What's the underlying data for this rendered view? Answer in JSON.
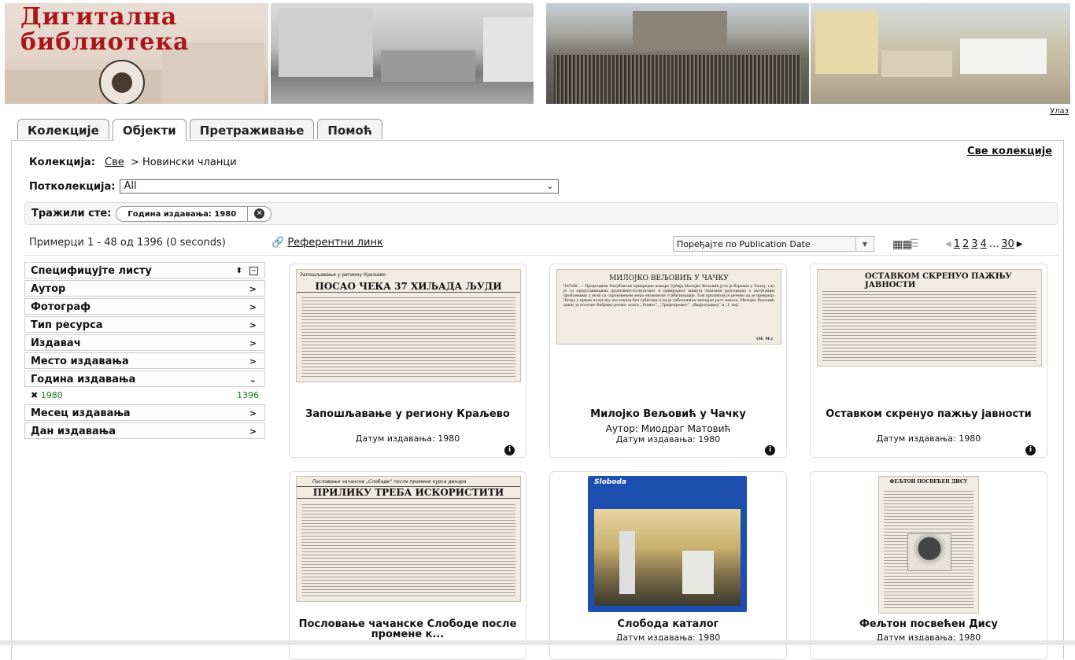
{
  "banner": {
    "title_line1": "Дигитална",
    "title_line2": "библиотека",
    "seal_text": "Градска библиотека Владислав Петковић Дис Чачак"
  },
  "header": {
    "exit_label": "Улаз"
  },
  "tabs": [
    {
      "label": "Колекције"
    },
    {
      "label": "Објекти"
    },
    {
      "label": "Претраживање"
    },
    {
      "label": "Помоћ"
    }
  ],
  "collection": {
    "label": "Колекција:",
    "all_link": "Све",
    "separator": ">",
    "current": "Новински чланци",
    "all_collections_link": "Све колекције"
  },
  "subcollection": {
    "label": "Потколекција:",
    "value": "All"
  },
  "searched": {
    "label": "Тражили сте:",
    "chip": "Година издавања: 1980"
  },
  "results": {
    "summary": "Примерци 1 - 48 од 1396 (0 seconds)",
    "ref_link": "Референтни линк",
    "sort_value": "Поређајте по Publication Date"
  },
  "pager": {
    "prev": "◀",
    "pages": [
      "1",
      "2",
      "3",
      "4"
    ],
    "ellipsis": "...",
    "last": "30",
    "next": "▶"
  },
  "facets": {
    "header": "Специфицујте листу",
    "items": [
      {
        "label": "Аутор"
      },
      {
        "label": "Фотограф"
      },
      {
        "label": "Тип ресурса"
      },
      {
        "label": "Издавач"
      },
      {
        "label": "Место издавања"
      },
      {
        "label": "Година издавања"
      },
      {
        "label": "Месец издавања"
      },
      {
        "label": "Дан издавања"
      }
    ],
    "year_value": {
      "label": "1980",
      "count": "1396"
    }
  },
  "cards": [
    {
      "title": "Запошљавање у региону Краљево",
      "meta": "Датум издавања: 1980",
      "thumb_kicker": "Запошљавање у региону Краљево",
      "thumb_headline": "ПОСАО ЧЕКА 37 ХИЉАДА ЉУДИ"
    },
    {
      "title": "Милојко Вељовић у Чачку",
      "meta": "Аутор: Миодраг Матовић",
      "meta2": "Датум издавања: 1980",
      "thumb_headline": "МИЛОЈКО ВЕЉОВИЋ У ЧАЧКУ",
      "thumb_body": "ЧАЧАК: — Председник Републичке привредне коморе Србије Милојко Вељовић јуче је боравио у Чачку, где је са представницима друштвено-политичког и привредног живота општине разговарао о актуелним проблемима у вези са спровођењем мера економске стабилизације. Том приликом је речено да је привреда Чачка у првом полугођу пословала без губитака и да је забележила значајан раст извоза. Милојко Вељовић данас је посетио Фабрику резног алата „Техмос“, „Трафопромет“, „Хидроградњу“ и „1. мај“.",
      "thumb_sig": "(М. М.)"
    },
    {
      "title": "Оставком скренуо пажњу јавности",
      "meta": "Датум издавања: 1980",
      "thumb_headline": "ОСТАВКОМ СКРЕНУО ПАЖЊУ ЈАВНОСТИ"
    },
    {
      "title": "Пословање чачанске Слободе после промене к...",
      "thumb_kicker": "Пословање чачанске „Слободе“ после промене курса динара",
      "thumb_headline": "ПРИЛИКУ ТРЕБА ИСКОРИСТИТИ"
    },
    {
      "title": "Слобода каталог",
      "meta": "Датум издавања: 1980",
      "thumb_brand": "Sloboda"
    },
    {
      "title": "Фељтон посвећен Дису",
      "meta": "Датум издавања: 1980",
      "thumb_kicker": "ФЕЉТОН ПОСВЕЋЕН ДИСУ"
    }
  ],
  "colors": {
    "banner_red": "#a8161a",
    "facet_green": "#1a7a20",
    "slobota_blue": "#1d4fb0"
  },
  "icons": [
    "seal-logo",
    "link-icon",
    "grid-view-icon",
    "list-view-icon",
    "info-icon",
    "remove-filter-icon",
    "chevron-right-icon",
    "chevron-down-icon"
  ]
}
